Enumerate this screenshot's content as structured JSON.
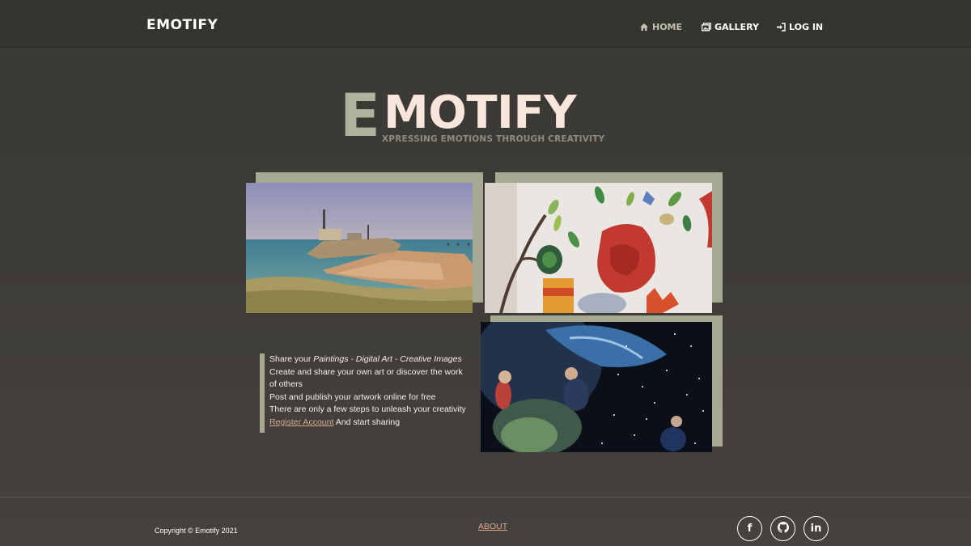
{
  "navbar": {
    "brand": "EMOTIFY",
    "items": [
      {
        "label": "HOME",
        "icon": "home-icon",
        "active": true
      },
      {
        "label": "GALLERY",
        "icon": "gallery-icon",
        "active": false
      },
      {
        "label": "LOG IN",
        "icon": "login-icon",
        "active": false
      }
    ]
  },
  "hero": {
    "title_first_letter": "E",
    "title_rest": "MOTIFY",
    "tagline": "XPRESSING EMOTIONS THROUGH CREATIVITY"
  },
  "gallery": {
    "images": [
      {
        "name": "shipwreck-photo",
        "subject": "shipwreck on rocky coast"
      },
      {
        "name": "painting-photo",
        "subject": "colorful leaves and flowers painting"
      },
      {
        "name": "space-art-photo",
        "subject": "digital art of people floating in space"
      }
    ]
  },
  "info": {
    "line1_prefix": "Share your ",
    "line1_emphasis": "Paintings - Digital Art - Creative Images",
    "line2": "Create and share your own art or discover the work of others",
    "line3": "Post and publish your artwork online for free",
    "line4": "There are only a few steps to unleash your creativity",
    "register_link": "Register Account",
    "line5_suffix": " And start sharing"
  },
  "footer": {
    "copyright": "Copyright © Emotify 2021",
    "about": "ABOUT",
    "social": [
      {
        "icon": "facebook-icon",
        "glyph": "f"
      },
      {
        "icon": "github-icon",
        "glyph": ""
      },
      {
        "icon": "linkedin-icon",
        "glyph": "in"
      }
    ]
  },
  "colors": {
    "background": "#3d3b36",
    "accent_sage": "#a6a892",
    "hero_text": "#f8e6dc",
    "link": "#d8ab8d"
  }
}
